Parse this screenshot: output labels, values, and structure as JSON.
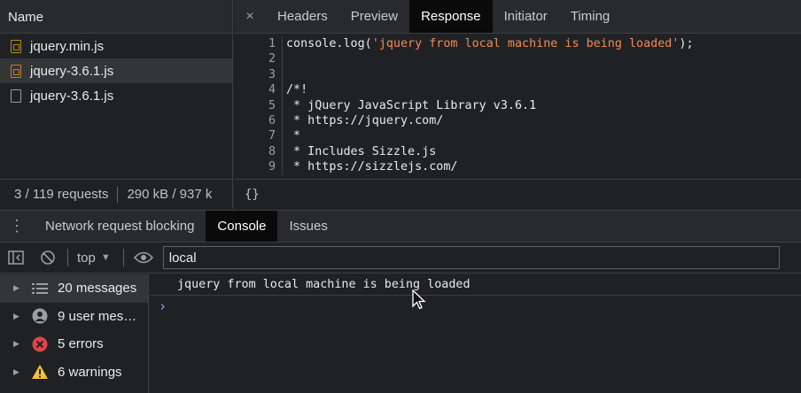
{
  "network": {
    "name_header": "Name",
    "files": [
      {
        "name": "jquery.min.js",
        "type": "script"
      },
      {
        "name": "jquery-3.6.1.js",
        "type": "script"
      },
      {
        "name": "jquery-3.6.1.js",
        "type": "document"
      }
    ],
    "status": {
      "requests": "3 / 119 requests",
      "transferred": "290 kB / 937 k"
    }
  },
  "detail": {
    "close_glyph": "×",
    "tabs": [
      "Headers",
      "Preview",
      "Response",
      "Initiator",
      "Timing"
    ],
    "active_tab": "Response",
    "pretty_print_glyph": "{}",
    "code_lines": [
      {
        "num": "1",
        "text": "console.log(",
        "str": "'jquery from local machine is being loaded'",
        "tail": ");"
      },
      {
        "num": "2",
        "text": ""
      },
      {
        "num": "3",
        "text": ""
      },
      {
        "num": "4",
        "text": "/*!"
      },
      {
        "num": "5",
        "text": " * jQuery JavaScript Library v3.6.1"
      },
      {
        "num": "6",
        "text": " * https://jquery.com/"
      },
      {
        "num": "7",
        "text": " *"
      },
      {
        "num": "8",
        "text": " * Includes Sizzle.js"
      },
      {
        "num": "9",
        "text": " * https://sizzlejs.com/"
      }
    ]
  },
  "drawer": {
    "menu_glyph": "⋮",
    "tabs": [
      "Network request blocking",
      "Console",
      "Issues"
    ],
    "active_tab": "Console"
  },
  "console": {
    "context": "top",
    "filter_value": "local",
    "sidebar": [
      {
        "label": "20 messages",
        "icon": "list-icon"
      },
      {
        "label": "9 user mes…",
        "icon": "user-icon"
      },
      {
        "label": "5 errors",
        "icon": "error-icon"
      },
      {
        "label": "6 warnings",
        "icon": "warning-icon"
      }
    ],
    "messages": [
      "jquery from local machine is being loaded"
    ],
    "prompt_glyph": "›"
  },
  "colors": {
    "accent_blue": "#8ab4f8",
    "error_red": "#e04545",
    "warning_yellow": "#f3c234",
    "string_orange": "#f28b54"
  }
}
